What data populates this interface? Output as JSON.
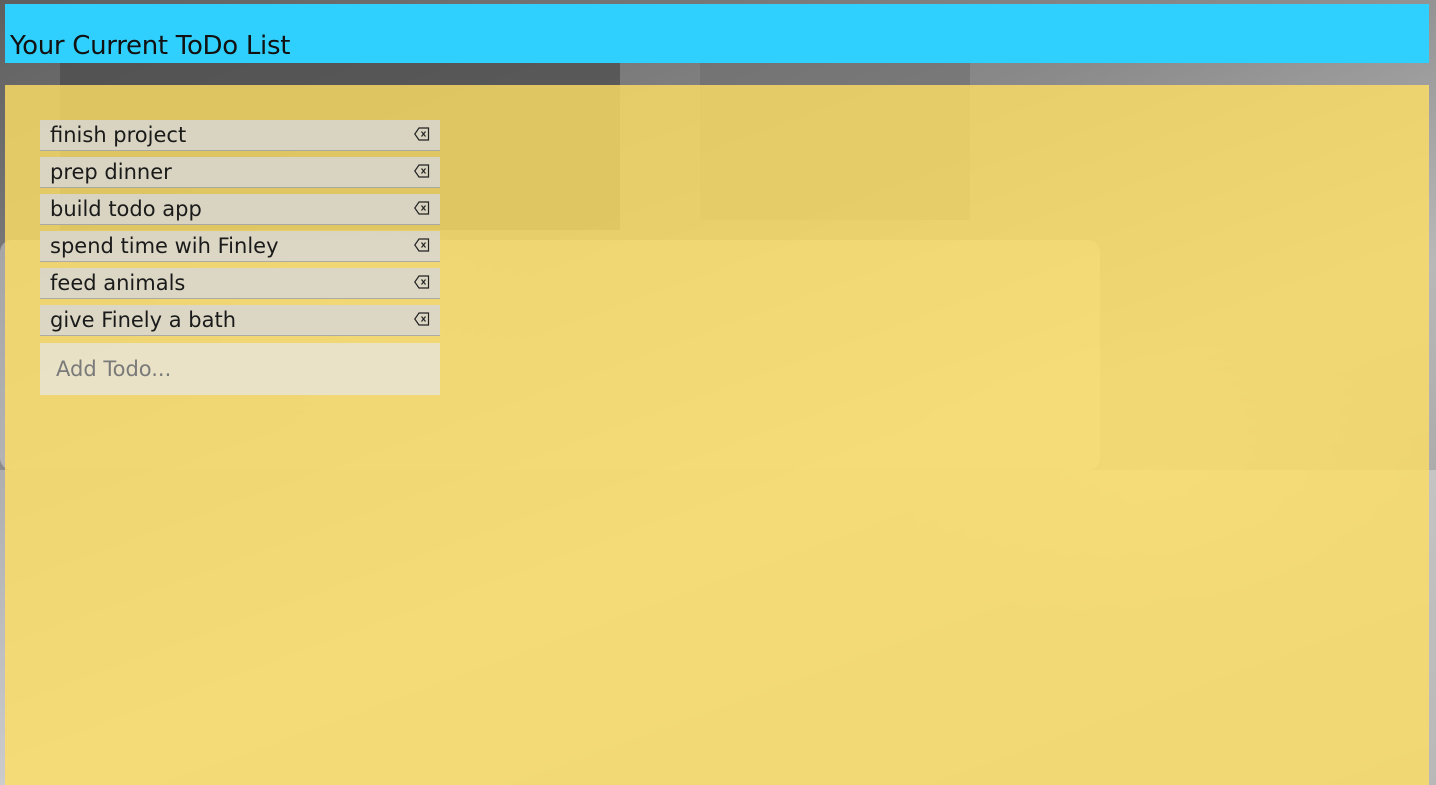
{
  "header": {
    "title": "Your Current ToDo List"
  },
  "todos": [
    {
      "text": "finish project",
      "delete_icon": "backspace-x-icon"
    },
    {
      "text": "prep dinner",
      "delete_icon": "backspace-x-icon"
    },
    {
      "text": "build todo app",
      "delete_icon": "backspace-x-icon"
    },
    {
      "text": "spend time wih Finley",
      "delete_icon": "backspace-x-icon"
    },
    {
      "text": "feed animals",
      "delete_icon": "backspace-x-icon"
    },
    {
      "text": "give Finely a bath",
      "delete_icon": "backspace-x-icon"
    }
  ],
  "add_todo": {
    "placeholder": "Add Todo...",
    "value": ""
  },
  "colors": {
    "header_bg": "#30d0fe",
    "panel_bg": "#fdde64",
    "item_bg": "#d7d7d7"
  }
}
